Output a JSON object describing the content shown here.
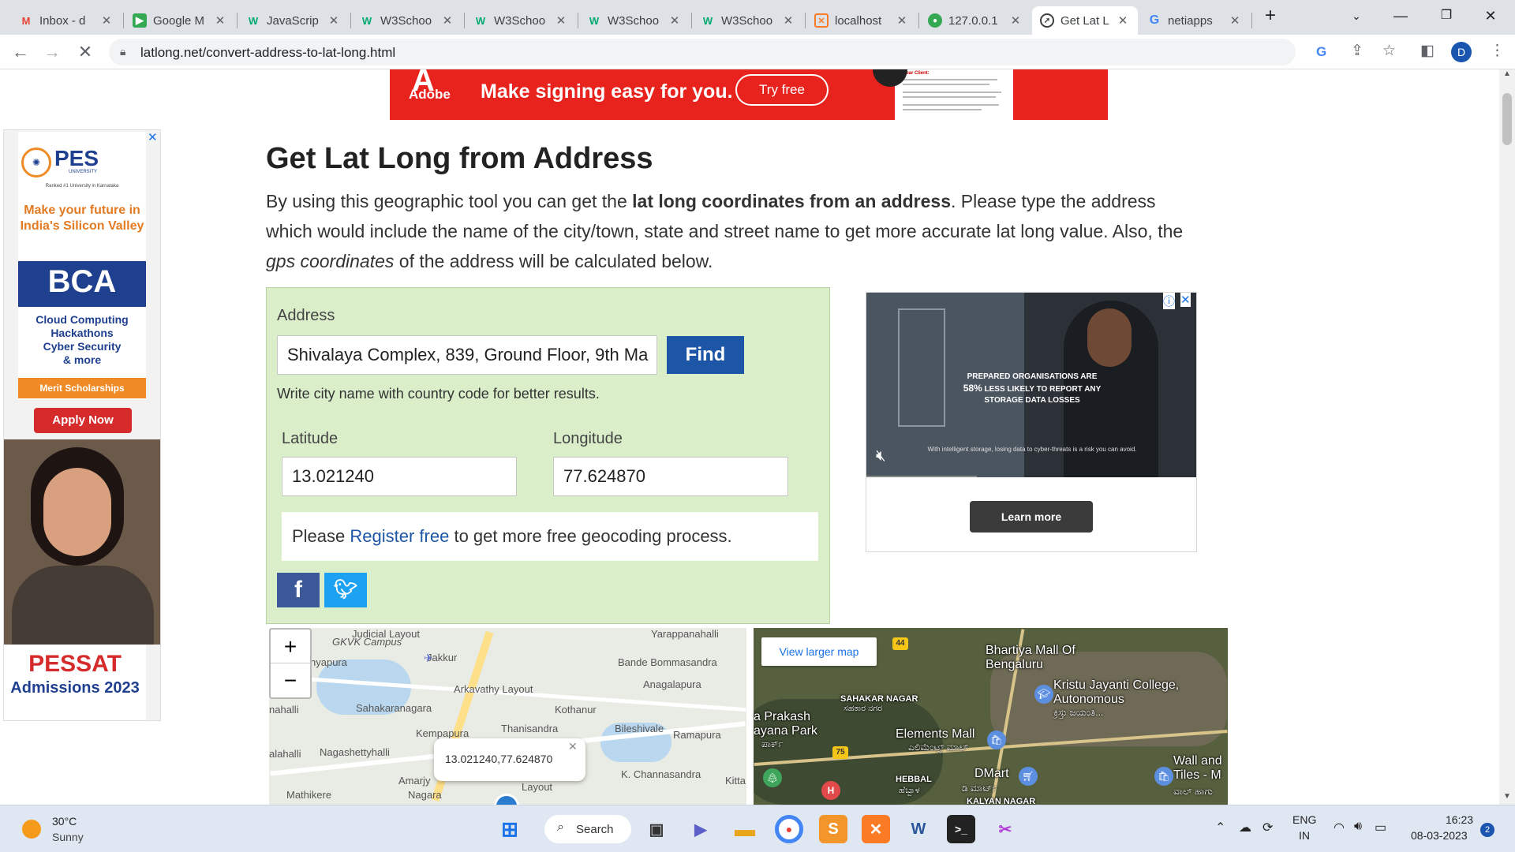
{
  "browser": {
    "tabs": [
      {
        "title": "Inbox - d",
        "icon": "gmail-icon"
      },
      {
        "title": "Google M",
        "icon": "google-meet-icon"
      },
      {
        "title": "JavaScrip",
        "icon": "w3schools-icon"
      },
      {
        "title": "W3Schoo",
        "icon": "w3schools-icon"
      },
      {
        "title": "W3Schoo",
        "icon": "w3schools-icon"
      },
      {
        "title": "W3Schoo",
        "icon": "w3schools-icon"
      },
      {
        "title": "W3Schoo",
        "icon": "w3schools-icon"
      },
      {
        "title": "localhost",
        "icon": "xampp-icon"
      },
      {
        "title": "127.0.0.1",
        "icon": "server-icon"
      },
      {
        "title": "Get Lat L",
        "icon": "compass-icon"
      },
      {
        "title": "netiapps",
        "icon": "google-icon"
      }
    ],
    "url": "latlong.net/convert-address-to-lat-long.html",
    "profile_initial": "D"
  },
  "ads": {
    "top": {
      "brand": "Adobe",
      "headline": "Make signing easy for you.",
      "cta": "Try free",
      "doc_heading": "Dear Client:"
    },
    "left": {
      "logo": "PES",
      "logo_sub": "UNIVERSITY",
      "rank_line": "Ranked #1 University in Karnataka",
      "tagline": "Make your future in India's Silicon Valley",
      "program": "BCA",
      "features": [
        "Cloud Computing",
        "Hackathons",
        "Cyber Security",
        "& more"
      ],
      "scholarship": "Merit Scholarships",
      "cta": "Apply Now",
      "exam": "PESSAT",
      "admissions": "Admissions 2023"
    },
    "right": {
      "headline_pre": "PREPARED ORGANISATIONS ARE",
      "headline_stat": "58%",
      "headline_post": "LESS LIKELY TO REPORT ANY STORAGE DATA LOSSES",
      "caption": "With intelligent storage, losing data to cyber-threats is a risk you can avoid.",
      "cta": "Learn more"
    }
  },
  "content": {
    "title": "Get Lat Long from Address",
    "intro_1": "By using this geographic tool you can get the ",
    "intro_bold": "lat long coordinates from an address",
    "intro_2": ". Please type the address which would include the name of the city/town, state and street name to get more accurate lat long value. Also, the ",
    "intro_italic": "gps coordinates",
    "intro_3": " of the address will be calculated below."
  },
  "form": {
    "address_label": "Address",
    "address_value": "Shivalaya Complex, 839, Ground Floor, 9th Ma",
    "find_label": "Find",
    "hint": "Write city name with country code for better results.",
    "latitude_label": "Latitude",
    "latitude_value": "13.021240",
    "longitude_label": "Longitude",
    "longitude_value": "77.624870",
    "register_pre": "Please ",
    "register_link": "Register free",
    "register_post": " to get more free geocoding process.",
    "share": [
      "facebook",
      "twitter"
    ]
  },
  "map1": {
    "zoom_in": "+",
    "zoom_out": "−",
    "popup": "13.021240,77.624870",
    "labels": [
      "Judicial Layout",
      "GKVK Campus",
      "Jakkur",
      "Yarappanahalli",
      "Bande Bommasandra",
      "nyapura",
      "Anagalapura",
      "Arkavathy Layout",
      "Sahakaranagara",
      "Kothanur",
      "nahalli",
      "Thanisandra",
      "Kempapura",
      "Bileshivale",
      "Ramapura",
      "alahalli",
      "Nagashettyhalli",
      "K. Channasandra",
      "Amarjy",
      "Layout",
      "Kitta",
      "Mathikere",
      "Nagara"
    ]
  },
  "map2": {
    "view_larger": "View larger map",
    "labels": [
      "Bhartiya Mall Of Bengaluru",
      "Kristu Jayanti College, Autonomous",
      "SAHAKAR NAGAR",
      "a Prakash ayana Park",
      "Elements Mall",
      "DMart",
      "Wall and Tiles - M",
      "HEBBAL",
      "KALYAN NAGAR"
    ],
    "kannada": [
      "ಸಹಕಾರ ನಗರ",
      "ಕ್ರಿಸ್ತು ಜಯಂತಿ...",
      "ಎಲಿಮೆಂಟ್ಸ್ ಮಾಲ್",
      "ಡಿ ಮಾರ್ಟ್",
      "ಹೆಬ್ಬಾಳ",
      "ಪಾರ್ಕ್",
      "ವಾಲ್ ಹಾಗು"
    ],
    "route_badges": [
      "44",
      "75"
    ]
  },
  "taskbar": {
    "weather_temp": "30°C",
    "weather_desc": "Sunny",
    "search": "Search",
    "lang": "ENG",
    "region": "IN",
    "time": "16:23",
    "date": "08-03-2023",
    "notifications": "2"
  }
}
